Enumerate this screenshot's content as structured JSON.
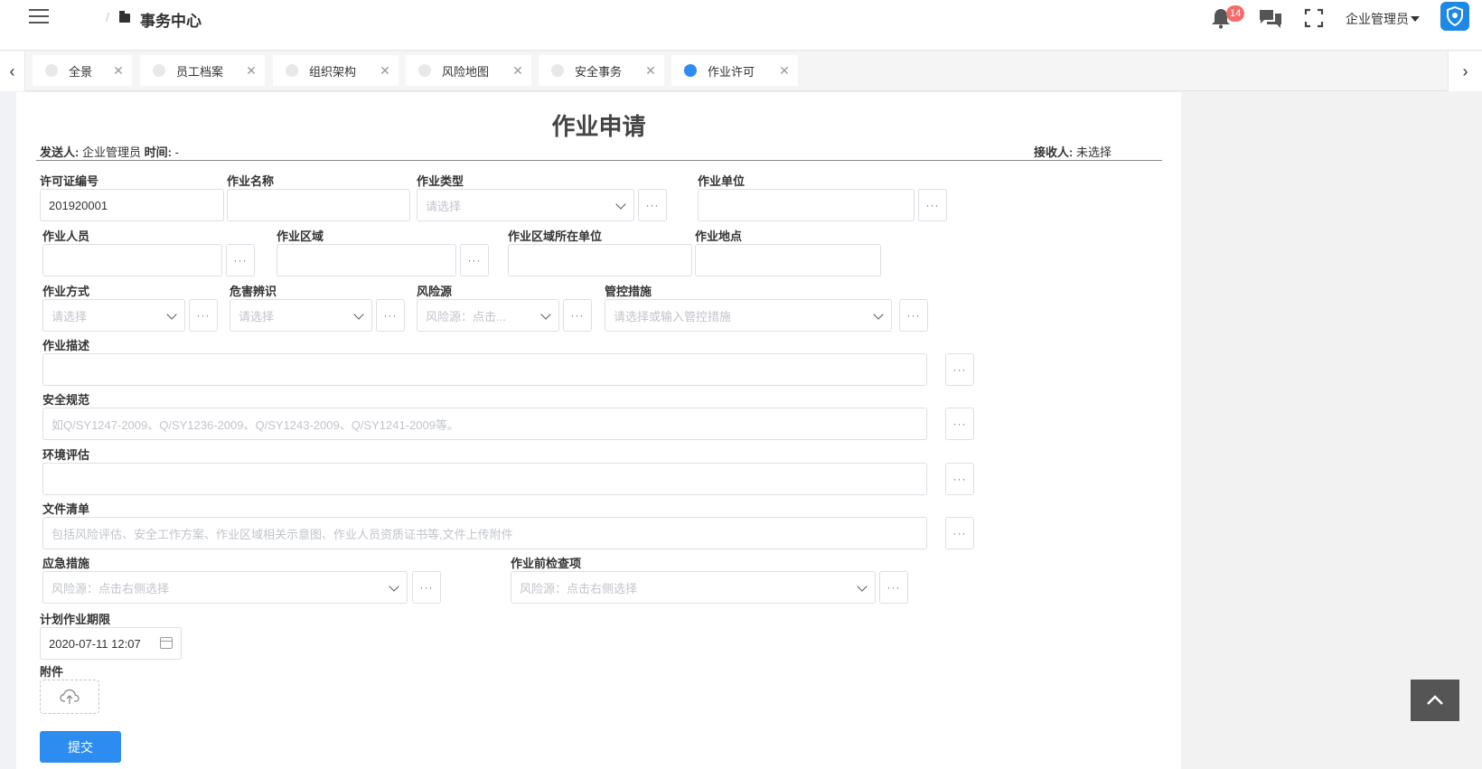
{
  "header": {
    "breadcrumb_sep": "/",
    "breadcrumb_title": "事务中心",
    "notifications_count": "14",
    "user_name": "企业管理员"
  },
  "tabs": [
    {
      "label": "全景",
      "active": false
    },
    {
      "label": "员工档案",
      "active": false
    },
    {
      "label": "组织架构",
      "active": false
    },
    {
      "label": "风险地图",
      "active": false
    },
    {
      "label": "安全事务",
      "active": false
    },
    {
      "label": "作业许可",
      "active": true
    }
  ],
  "form": {
    "title": "作业申请",
    "sender_label": "发送人:",
    "sender_value": "企业管理员",
    "time_label": "时间:",
    "time_value": "-",
    "receiver_label": "接收人:",
    "receiver_value": "未选择",
    "fields": {
      "permit_no": {
        "label": "许可证编号",
        "value": "201920001"
      },
      "job_name": {
        "label": "作业名称"
      },
      "job_type": {
        "label": "作业类型",
        "placeholder": "请选择"
      },
      "job_unit": {
        "label": "作业单位"
      },
      "job_personnel": {
        "label": "作业人员"
      },
      "job_area": {
        "label": "作业区域"
      },
      "area_unit": {
        "label": "作业区域所在单位"
      },
      "job_location": {
        "label": "作业地点"
      },
      "job_method": {
        "label": "作业方式",
        "placeholder": "请选择"
      },
      "hazard_id": {
        "label": "危害辨识",
        "placeholder": "请选择"
      },
      "risk_source": {
        "label": "风险源",
        "placeholder": "风险源：点击..."
      },
      "control_measures": {
        "label": "管控措施",
        "placeholder": "请选择或输入管控措施"
      },
      "job_description": {
        "label": "作业描述"
      },
      "safety_standard": {
        "label": "安全规范",
        "placeholder": "如Q/SY1247-2009、Q/SY1236-2009、Q/SY1243-2009、Q/SY1241-2009等。"
      },
      "env_assessment": {
        "label": "环境评估"
      },
      "file_list": {
        "label": "文件清单",
        "placeholder": "包括风险评估、安全工作方案、作业区域相关示意图、作业人员资质证书等,文件上传附件"
      },
      "emergency": {
        "label": "应急措施",
        "placeholder": "风险源：点击右侧选择"
      },
      "pre_check": {
        "label": "作业前检查项",
        "placeholder": "风险源：点击右侧选择"
      },
      "plan_deadline": {
        "label": "计划作业期限",
        "value": "2020-07-11 12:07"
      },
      "attachment": {
        "label": "附件"
      }
    },
    "more_label": "···",
    "submit_label": "提交"
  },
  "icons": {
    "menu": "hamburger-icon",
    "breadcrumb": "folder-icon",
    "notifications": "bell-icon",
    "messages": "chat-icon",
    "fullscreen": "fullscreen-icon",
    "upload": "cloud-upload-icon",
    "calendar": "calendar-icon",
    "back_to_top": "chevron-up-icon"
  },
  "colors": {
    "primary": "#2d8cf0",
    "badge": "#f56c6c",
    "avatar": "#1e88e5"
  }
}
